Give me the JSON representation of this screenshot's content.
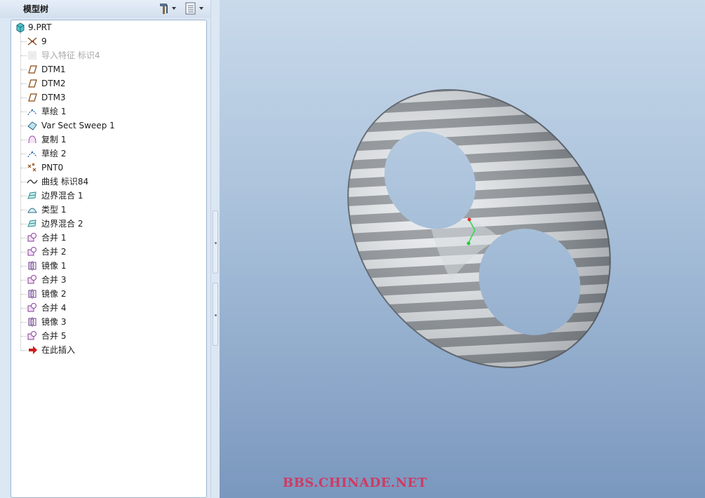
{
  "panel": {
    "title": "模型树",
    "tools": [
      {
        "icon": "hammer-settings-icon"
      },
      {
        "icon": "list-settings-icon"
      }
    ]
  },
  "tree": {
    "root": {
      "label": "9.PRT",
      "icon": "part-cube-icon"
    },
    "items": [
      {
        "label": "9",
        "icon": "csys-icon",
        "disabled": false
      },
      {
        "label": "导入特征 标识4",
        "icon": "import-feature-icon",
        "disabled": true
      },
      {
        "label": "DTM1",
        "icon": "datum-plane-icon",
        "disabled": false
      },
      {
        "label": "DTM2",
        "icon": "datum-plane-icon",
        "disabled": false
      },
      {
        "label": "DTM3",
        "icon": "datum-plane-icon",
        "disabled": false
      },
      {
        "label": "草绘 1",
        "icon": "sketch-icon",
        "disabled": false
      },
      {
        "label": "Var Sect Sweep 1",
        "icon": "var-sect-sweep-icon",
        "disabled": false
      },
      {
        "label": "复制 1",
        "icon": "copy-surface-icon",
        "disabled": false
      },
      {
        "label": "草绘 2",
        "icon": "sketch-icon",
        "disabled": false
      },
      {
        "label": "PNT0",
        "icon": "datum-point-icon",
        "disabled": false
      },
      {
        "label": "曲线 标识84",
        "icon": "curve-icon",
        "disabled": false
      },
      {
        "label": "边界混合 1",
        "icon": "boundary-blend-icon",
        "disabled": false
      },
      {
        "label": "类型 1",
        "icon": "type-surface-icon",
        "disabled": false
      },
      {
        "label": "边界混合 2",
        "icon": "boundary-blend-icon",
        "disabled": false
      },
      {
        "label": "合并 1",
        "icon": "merge-icon",
        "disabled": false
      },
      {
        "label": "合并 2",
        "icon": "merge-icon",
        "disabled": false
      },
      {
        "label": "镜像 1",
        "icon": "mirror-icon",
        "disabled": false
      },
      {
        "label": "合并 3",
        "icon": "merge-icon",
        "disabled": false
      },
      {
        "label": "镜像 2",
        "icon": "mirror-icon",
        "disabled": false
      },
      {
        "label": "合并 4",
        "icon": "merge-icon",
        "disabled": false
      },
      {
        "label": "镜像 3",
        "icon": "mirror-icon",
        "disabled": false
      },
      {
        "label": "合并 5",
        "icon": "merge-icon",
        "disabled": false
      },
      {
        "label": "在此插入",
        "icon": "insert-here-arrow-icon",
        "disabled": false
      }
    ]
  },
  "viewport": {
    "watermark": "BBS.CHINADE.NET",
    "model": "zebra-striped-double-ring-surface"
  },
  "colors": {
    "viewport_top": "#c9daeb",
    "viewport_bottom": "#7a97be",
    "stripe_light": "#e9ecef",
    "stripe_dark": "#8f9499",
    "watermark": "#cf3a63"
  }
}
